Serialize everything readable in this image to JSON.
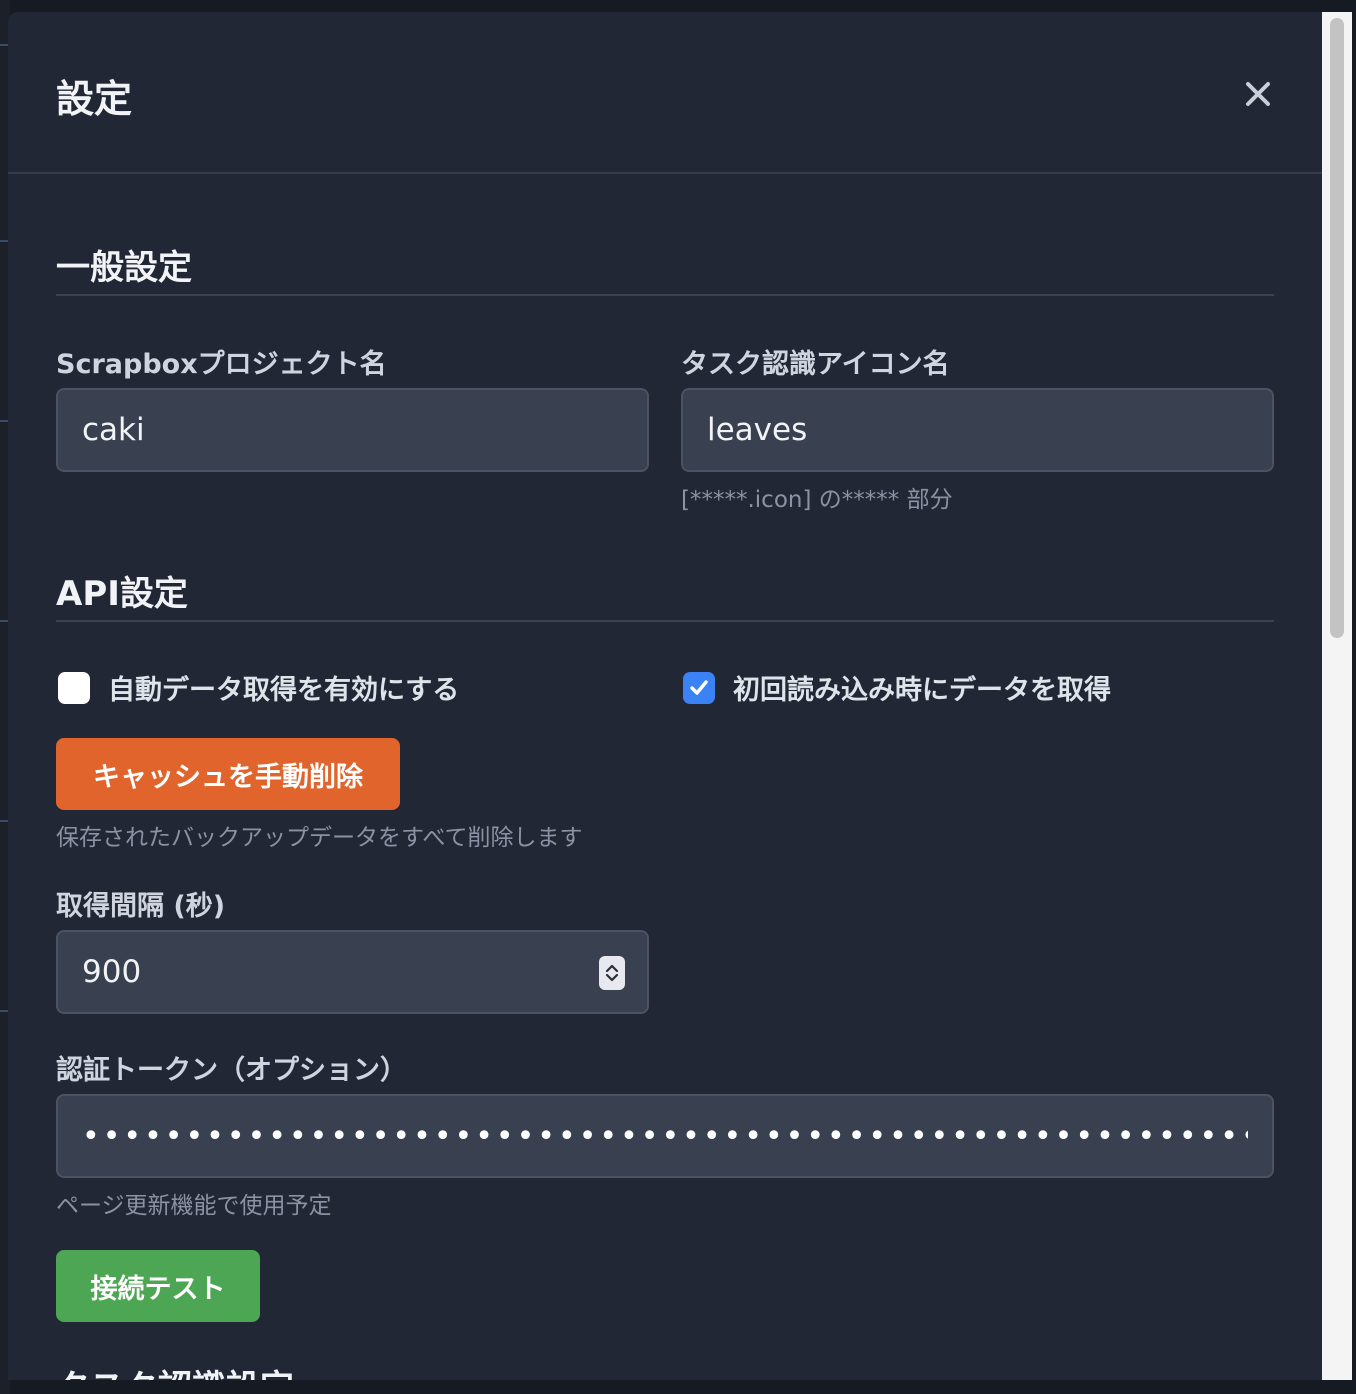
{
  "modal": {
    "title": "設定",
    "close_icon": "close-icon"
  },
  "general": {
    "section_title": "一般設定",
    "project_label": "Scrapboxプロジェクト名",
    "project_value": "caki",
    "icon_label": "タスク認識アイコン名",
    "icon_value": "leaves",
    "icon_hint": "[*****.icon] の***** 部分"
  },
  "api": {
    "section_title": "API設定",
    "auto_fetch_label": "自動データ取得を有効にする",
    "auto_fetch_checked": false,
    "initial_fetch_label": "初回読み込み時にデータを取得",
    "initial_fetch_checked": true,
    "clear_cache_label": "キャッシュを手動削除",
    "clear_cache_hint": "保存されたバックアップデータをすべて削除します",
    "interval_label": "取得間隔 (秒)",
    "interval_value": "900",
    "token_label": "認証トークン（オプション）",
    "token_value": "••••••••••••••••••••••••••••••••••••••••••••••••••••••••••••••••••",
    "token_hint": "ページ更新機能で使用予定",
    "test_button_label": "接続テスト"
  },
  "task": {
    "section_title": "タスク認識設定"
  },
  "colors": {
    "modal_bg": "#212735",
    "input_bg": "#394050",
    "orange": "#e0642b",
    "green": "#4ca653",
    "checkbox_blue": "#3b82f6"
  }
}
